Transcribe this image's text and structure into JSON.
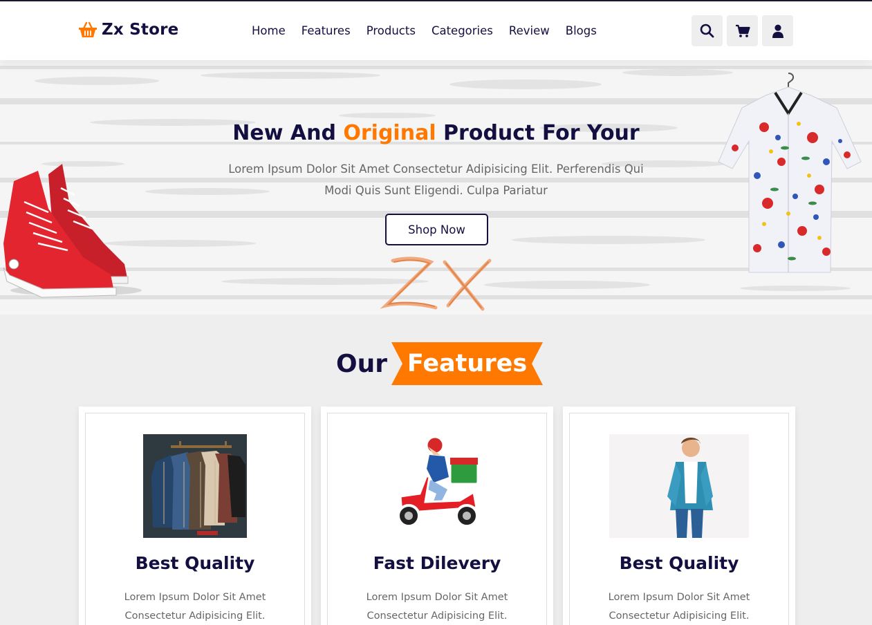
{
  "brand": {
    "name": "Zx Store",
    "icon": "basket-icon",
    "accent_color": "#ff7800",
    "text_color": "#130f40"
  },
  "nav": {
    "items": [
      "Home",
      "Features",
      "Products",
      "Categories",
      "Review",
      "Blogs"
    ]
  },
  "header_icons": [
    "search-icon",
    "cart-icon",
    "user-icon"
  ],
  "hero": {
    "title_before": "New And ",
    "title_accent": "Original",
    "title_after": " Product For Your",
    "description": "Lorem Ipsum Dolor Sit Amet Consectetur Adipisicing Elit. Perferendis Qui Modi Quis Sunt Eligendi. Culpa Pariatur",
    "button_label": "Shop Now"
  },
  "features": {
    "heading_plain": "Our",
    "heading_tag": "Features",
    "cards": [
      {
        "title": "Best Quality",
        "text": "Lorem Ipsum Dolor Sit Amet Consectetur Adipisicing Elit."
      },
      {
        "title": "Fast Dilevery",
        "text": "Lorem Ipsum Dolor Sit Amet Consectetur Adipisicing Elit."
      },
      {
        "title": "Best Quality",
        "text": "Lorem Ipsum Dolor Sit Amet Consectetur Adipisicing Elit."
      }
    ]
  }
}
